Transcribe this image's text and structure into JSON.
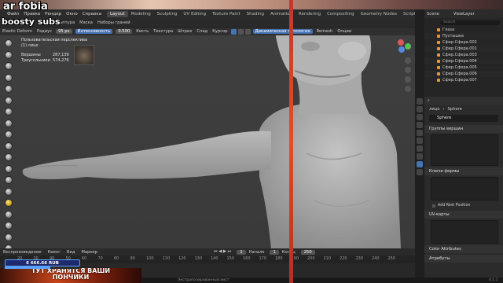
{
  "stream": {
    "title": "ar fobia",
    "subtitle": "boosty subs",
    "donation": "6 666.66 RUB",
    "banner": "ТУТ ХРАНЯТСЯ ВАШИ ПОНЧИКИ"
  },
  "menubar": {
    "items": [
      "Файл",
      "Правка",
      "Рендер",
      "Окно",
      "Справка"
    ],
    "workspaces": [
      "Layout",
      "Modeling",
      "Sculpting",
      "UV Editing",
      "Texture Paint",
      "Shading",
      "Animation",
      "Rendering",
      "Compositing",
      "Geometry Nodes",
      "Scripting"
    ]
  },
  "subbar": {
    "items": [
      "Скульптура",
      "Маска",
      "Наборы граней"
    ]
  },
  "toolheader": {
    "brush": "Elastic Deform",
    "radius_label": "Радиус",
    "radius_value": "95 px",
    "strength_label": "Интенсивность",
    "strength_value": "0.500",
    "items": [
      "Кисть",
      "Текстура",
      "Штрих",
      "Спад",
      "Курсор"
    ],
    "dyntopo": "Динамическая топология",
    "remesh": "Remesh",
    "options": "Опции"
  },
  "overlay": {
    "view": "Пользовательская перспектива",
    "object": "(1) лицо",
    "verts_label": "Вершины",
    "verts_value": "287,139",
    "tris_label": "Треугольники",
    "tris_value": "574,276"
  },
  "timeline": {
    "items": [
      "Воспроизведение",
      "Кеинг",
      "Вид",
      "Маркер"
    ],
    "frame": "1",
    "start_label": "Начало",
    "start_value": "1",
    "end_label": "Конец",
    "end_value": "250",
    "ticks": [
      "20",
      "30",
      "40",
      "50",
      "60",
      "70",
      "80",
      "90",
      "100",
      "110",
      "120",
      "130",
      "140",
      "150",
      "160",
      "170",
      "180",
      "190",
      "200",
      "210",
      "220",
      "230",
      "240",
      "250"
    ]
  },
  "status": {
    "left": "Повернуть вид",
    "right": "Экстраполированный лист",
    "version": "4.1.1"
  },
  "outliner": {
    "header": "Scene",
    "viewlayer": "ViewLayer",
    "search": "Search",
    "items": [
      "Глаза",
      "Пустышка",
      "Сфер.Сфера.002",
      "Сфер.Сфера.001",
      "Сфер.Сфера.003",
      "Сфер.Сфера.004",
      "Сфер.Сфера.005",
      "Сфер.Сфера.006",
      "Сфер.Сфера.007"
    ]
  },
  "properties": {
    "crumb": "лицо",
    "crumb2": "Sphere",
    "object": "Sphere",
    "sections": [
      "Группы вершин",
      "Ключи формы",
      "UV-карты",
      "Color Attributes",
      "Атрибуты"
    ],
    "add_rest": "Add Rest Position"
  }
}
